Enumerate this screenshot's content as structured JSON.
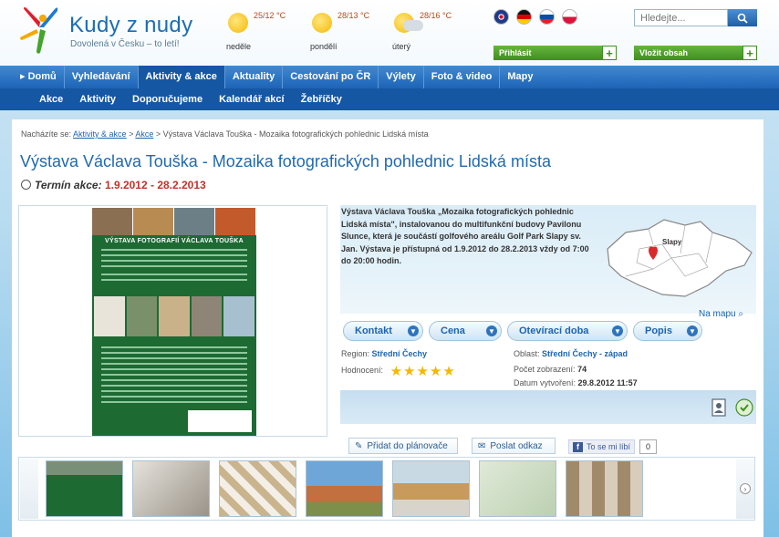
{
  "header": {
    "logo_title": "Kudy z nudy",
    "logo_sub": "Dovolená v Česku – to letí!",
    "weather": [
      {
        "temp": "25/12 °C",
        "day": "neděle",
        "icon": "sun-icon"
      },
      {
        "temp": "28/13 °C",
        "day": "pondělí",
        "icon": "sun-icon"
      },
      {
        "temp": "28/16 °C",
        "day": "úterý",
        "icon": "sun-cloud-rain-icon"
      }
    ],
    "search_placeholder": "Hledejte...",
    "login_label": "Přihlásit",
    "add_content_label": "Vložit obsah"
  },
  "nav": {
    "main": [
      "Domů",
      "Vyhledávání",
      "Aktivity & akce",
      "Aktuality",
      "Cestování po ČR",
      "Výlety",
      "Foto & video",
      "Mapy"
    ],
    "sub": [
      "Akce",
      "Aktivity",
      "Doporučujeme",
      "Kalendář akcí",
      "Žebříčky"
    ]
  },
  "breadcrumb": {
    "prefix": "Nacházíte se:",
    "items": [
      "Aktivity & akce",
      "Akce"
    ],
    "current": "Výstava Václava Touška - Mozaika fotografických pohlednic Lidská místa"
  },
  "page": {
    "title": "Výstava Václava Touška - Mozaika fotografických pohlednic Lidská místa",
    "term_label": "Termín akce:",
    "term_value": "1.9.2012 - 28.2.2013"
  },
  "poster": {
    "title": "VÝSTAVA FOTOGRAFIÍ VÁCLAVA TOUŠKA"
  },
  "description": "Výstava Václava Touška „Mozaika fotografických pohlednic Lidská místa\", instalovanou do multifunkční budovy Pavilonu Slunce, která je součástí golfového areálu Golf Park Slapy sv. Jan. Výstava je přístupná od 1.9.2012 do 28.2.2013 vždy od 7:00 do 20:00 hodin.",
  "map": {
    "label": "Slapy",
    "link": "Na mapu"
  },
  "tabs": [
    "Kontakt",
    "Cena",
    "Otevírací doba",
    "Popis"
  ],
  "info": {
    "region_label": "Region:",
    "region_value": "Střední Čechy",
    "rating_label": "Hodnocení:",
    "rating_stars": 5,
    "area_label": "Oblast:",
    "area_value": "Střední Čechy - západ",
    "views_label": "Počet zobrazení:",
    "views_value": "74",
    "created_label": "Datum vytvoření:",
    "created_value": "29.8.2012 11:57"
  },
  "share": {
    "planner": "Přidat do plánovače",
    "send_link": "Poslat odkaz",
    "fb_like": "To se mi líbí",
    "fb_count": "0"
  },
  "colors": {
    "brand_blue": "#1e64b6",
    "nav_dark": "#1657a4",
    "accent_red": "#c0332b",
    "green": "#3f8f1f"
  }
}
